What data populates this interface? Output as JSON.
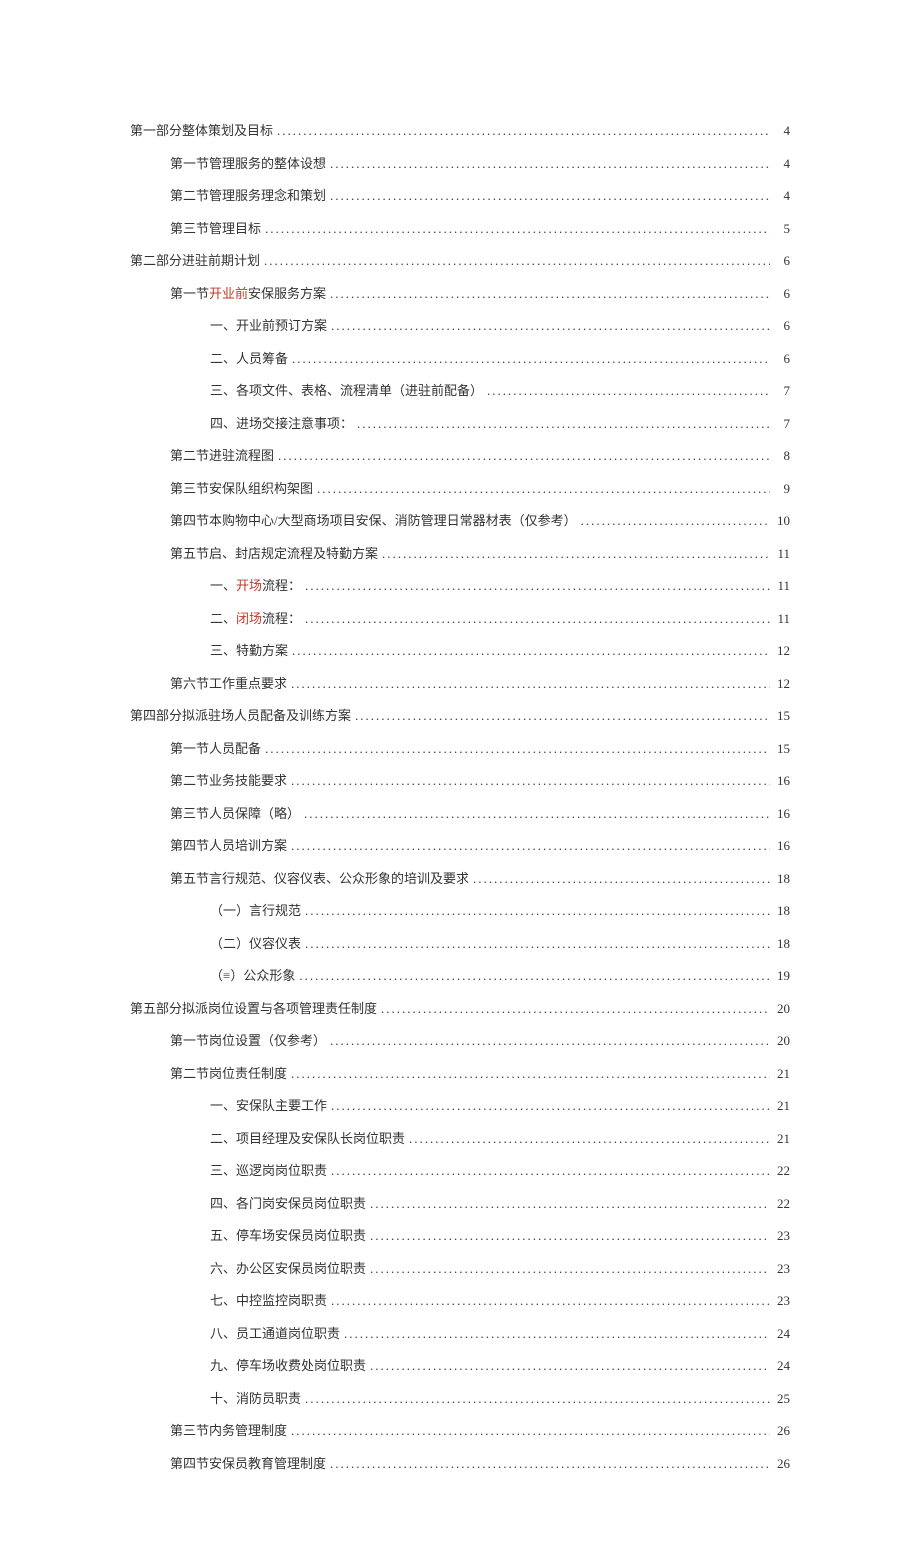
{
  "toc": [
    {
      "level": 0,
      "prefix": "",
      "text": "第一部分整体策划及目标",
      "page": "4",
      "hl": []
    },
    {
      "level": 1,
      "prefix": "",
      "text": "第一节管理服务的整体设想",
      "page": "4",
      "hl": []
    },
    {
      "level": 1,
      "prefix": "",
      "text": "第二节管理服务理念和策划",
      "page": "4",
      "hl": []
    },
    {
      "level": 1,
      "prefix": "",
      "text": "第三节管理目标",
      "page": "5",
      "hl": []
    },
    {
      "level": 0,
      "prefix": "",
      "text": "第二部分进驻前期计划",
      "page": "6",
      "hl": []
    },
    {
      "level": 1,
      "prefix": "",
      "text": "第一节|开业前|安保服务方案",
      "page": "6",
      "hl": [
        1
      ]
    },
    {
      "level": 2,
      "prefix": "",
      "text": "一、开业前预订方案",
      "page": "6",
      "hl": []
    },
    {
      "level": 2,
      "prefix": "",
      "text": "二、人员筹备",
      "page": "6",
      "hl": []
    },
    {
      "level": 2,
      "prefix": "",
      "text": "三、各项文件、表格、流程清单（进驻前配备）",
      "page": "7",
      "hl": []
    },
    {
      "level": 2,
      "prefix": "",
      "text": "四、进场交接注意事项：",
      "page": "7",
      "hl": []
    },
    {
      "level": 1,
      "prefix": "",
      "text": "第二节进驻流程图",
      "page": "8",
      "hl": []
    },
    {
      "level": 1,
      "prefix": "",
      "text": "第三节安保队组织构架图",
      "page": "9",
      "hl": []
    },
    {
      "level": 1,
      "prefix": "",
      "text": "第四节本购物中心/大型商场项目安保、消防管理日常器材表（仅参考）",
      "page": "10",
      "hl": []
    },
    {
      "level": 1,
      "prefix": "",
      "text": "第五节启、封店规定流程及特勤方案",
      "page": "11",
      "hl": []
    },
    {
      "level": 2,
      "prefix": "",
      "text": "一、|开场|流程：",
      "page": "11",
      "hl": [
        1
      ]
    },
    {
      "level": 2,
      "prefix": "",
      "text": "二、|闭场|流程：",
      "page": "11",
      "hl": [
        1
      ]
    },
    {
      "level": 2,
      "prefix": "",
      "text": "三、特勤方案",
      "page": "12",
      "hl": []
    },
    {
      "level": 1,
      "prefix": "",
      "text": "第六节工作重点要求",
      "page": "12",
      "hl": []
    },
    {
      "level": 0,
      "prefix": "",
      "text": "第四部分拟派驻场人员配备及训练方案",
      "page": "15",
      "hl": []
    },
    {
      "level": 1,
      "prefix": "",
      "text": "第一节人员配备",
      "page": "15",
      "hl": []
    },
    {
      "level": 1,
      "prefix": "",
      "text": "第二节业务技能要求",
      "page": "16",
      "hl": []
    },
    {
      "level": 1,
      "prefix": "",
      "text": "第三节人员保障（略）",
      "page": "16",
      "hl": []
    },
    {
      "level": 1,
      "prefix": "",
      "text": "第四节人员培训方案",
      "page": "16",
      "hl": []
    },
    {
      "level": 1,
      "prefix": "",
      "text": "第五节言行规范、仪容仪表、公众形象的培训及要求",
      "page": "18",
      "hl": []
    },
    {
      "level": 2,
      "prefix": "",
      "text": "（一）言行规范",
      "page": "18",
      "hl": []
    },
    {
      "level": 2,
      "prefix": "",
      "text": "（二）仪容仪表",
      "page": "18",
      "hl": []
    },
    {
      "level": 2,
      "prefix": "",
      "text": "（≡）公众形象",
      "page": "19",
      "hl": []
    },
    {
      "level": 0,
      "prefix": "",
      "text": "第五部分拟派岗位设置与各项管理责任制度",
      "page": "20",
      "hl": []
    },
    {
      "level": 1,
      "prefix": "",
      "text": "第一节岗位设置（仅参考）",
      "page": "20",
      "hl": []
    },
    {
      "level": 1,
      "prefix": "",
      "text": "第二节岗位责任制度",
      "page": "21",
      "hl": []
    },
    {
      "level": 2,
      "prefix": "",
      "text": "一、安保队主要工作",
      "page": "21",
      "hl": []
    },
    {
      "level": 2,
      "prefix": "",
      "text": "二、项目经理及安保队长岗位职责",
      "page": "21",
      "hl": []
    },
    {
      "level": 2,
      "prefix": "",
      "text": "三、巡逻岗岗位职责",
      "page": "22",
      "hl": []
    },
    {
      "level": 2,
      "prefix": "",
      "text": "四、各门岗安保员岗位职责",
      "page": "22",
      "hl": []
    },
    {
      "level": 2,
      "prefix": "",
      "text": "五、停车场安保员岗位职责",
      "page": "23",
      "hl": []
    },
    {
      "level": 2,
      "prefix": "",
      "text": "六、办公区安保员岗位职责",
      "page": "23",
      "hl": []
    },
    {
      "level": 2,
      "prefix": "",
      "text": "七、中控监控岗职责",
      "page": "23",
      "hl": []
    },
    {
      "level": 2,
      "prefix": "",
      "text": "八、员工通道岗位职责",
      "page": "24",
      "hl": []
    },
    {
      "level": 2,
      "prefix": "",
      "text": "九、停车场收费处岗位职责",
      "page": "24",
      "hl": []
    },
    {
      "level": 2,
      "prefix": "",
      "text": "十、消防员职责",
      "page": "25",
      "hl": []
    },
    {
      "level": 1,
      "prefix": "",
      "text": "第三节内务管理制度",
      "page": "26",
      "hl": []
    },
    {
      "level": 1,
      "prefix": "",
      "text": "第四节安保员教育管理制度",
      "page": "26",
      "hl": []
    }
  ]
}
